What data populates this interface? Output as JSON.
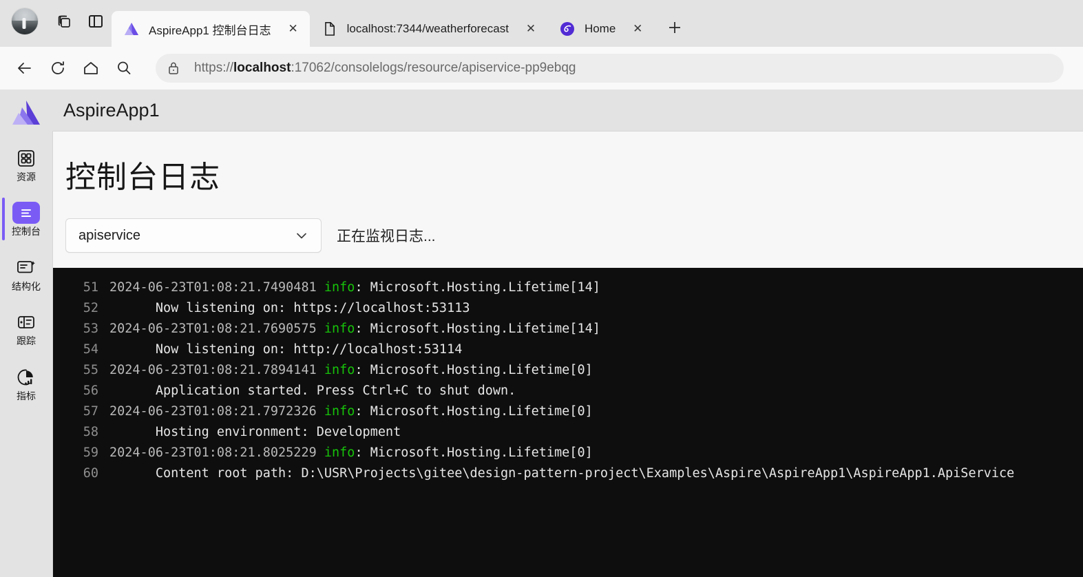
{
  "browser": {
    "profile_avatar": "user-photo",
    "toolbar_icons": [
      "tab-groups-icon",
      "split-screen-icon"
    ],
    "tabs": [
      {
        "title": "AspireApp1 控制台日志",
        "favicon": "aspire-logo-icon",
        "active": true,
        "close_label": "✕"
      },
      {
        "title": "localhost:7344/weatherforecast",
        "favicon": "page-icon",
        "active": false,
        "close_label": "✕"
      },
      {
        "title": "Home",
        "favicon": "blazor-icon",
        "active": false,
        "close_label": "✕"
      }
    ],
    "new_tab_label": "+",
    "nav": {
      "back_label": "back-arrow",
      "reload_label": "reload-arrow",
      "home_label": "home",
      "search_label": "search"
    },
    "address": {
      "lock_icon": "lock-icon",
      "scheme": "https://",
      "host_bold": "localhost",
      "rest": ":17062/consolelogs/resource/apiservice-pp9ebqg",
      "full_url": "https://localhost:17062/consolelogs/resource/apiservice-pp9ebqg"
    }
  },
  "app": {
    "title": "AspireApp1",
    "logo": "aspire-logo-icon",
    "page_title": "控制台日志",
    "sidebar": {
      "items": [
        {
          "label": "资源",
          "icon": "resources-grid-icon",
          "active": false
        },
        {
          "label": "控制台",
          "icon": "console-icon",
          "active": true
        },
        {
          "label": "结构化",
          "icon": "structured-logs-icon",
          "active": false
        },
        {
          "label": "跟踪",
          "icon": "traces-icon",
          "active": false
        },
        {
          "label": "指标",
          "icon": "metrics-icon",
          "active": false
        }
      ]
    },
    "resource_select": {
      "value": "apiservice",
      "chevron": "chevron-down-icon"
    },
    "watch_status": "正在监视日志...",
    "colors": {
      "accent": "#7A5CF5",
      "console_bg": "#0e0e0e",
      "info_green": "#17c20a",
      "sidebar_bg": "#e3e3e3"
    },
    "console_logs": [
      {
        "no": "51",
        "ts": "2024-06-23T01:08:21.7490481 ",
        "level": "info",
        "rest": ": Microsoft.Hosting.Lifetime[14]"
      },
      {
        "no": "52",
        "ts": "",
        "level": "",
        "rest": "      Now listening on: https://localhost:53113"
      },
      {
        "no": "53",
        "ts": "2024-06-23T01:08:21.7690575 ",
        "level": "info",
        "rest": ": Microsoft.Hosting.Lifetime[14]"
      },
      {
        "no": "54",
        "ts": "",
        "level": "",
        "rest": "      Now listening on: http://localhost:53114"
      },
      {
        "no": "55",
        "ts": "2024-06-23T01:08:21.7894141 ",
        "level": "info",
        "rest": ": Microsoft.Hosting.Lifetime[0]"
      },
      {
        "no": "56",
        "ts": "",
        "level": "",
        "rest": "      Application started. Press Ctrl+C to shut down."
      },
      {
        "no": "57",
        "ts": "2024-06-23T01:08:21.7972326 ",
        "level": "info",
        "rest": ": Microsoft.Hosting.Lifetime[0]"
      },
      {
        "no": "58",
        "ts": "",
        "level": "",
        "rest": "      Hosting environment: Development"
      },
      {
        "no": "59",
        "ts": "2024-06-23T01:08:21.8025229 ",
        "level": "info",
        "rest": ": Microsoft.Hosting.Lifetime[0]"
      },
      {
        "no": "60",
        "ts": "",
        "level": "",
        "rest": "      Content root path: D:\\USR\\Projects\\gitee\\design-pattern-project\\Examples\\Aspire\\AspireApp1\\AspireApp1.ApiService"
      }
    ]
  }
}
